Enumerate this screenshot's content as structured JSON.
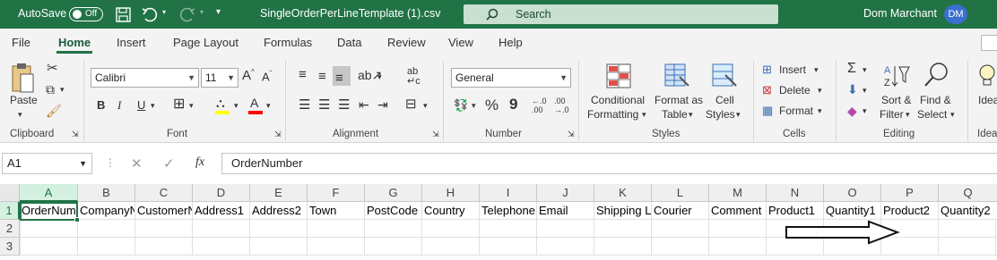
{
  "titlebar": {
    "autosave_label": "AutoSave",
    "autosave_state": "Off",
    "filename": "SingleOrderPerLineTemplate (1).csv",
    "search_placeholder": "Search",
    "user_name": "Dom Marchant",
    "user_initials": "DM",
    "icons": [
      "save-icon",
      "undo-icon",
      "redo-icon",
      "customize-icon",
      "search-icon"
    ]
  },
  "tabs": [
    "File",
    "Home",
    "Insert",
    "Page Layout",
    "Formulas",
    "Data",
    "Review",
    "View",
    "Help"
  ],
  "active_tab": "Home",
  "ribbon": {
    "clipboard": {
      "group": "Clipboard",
      "paste": "Paste"
    },
    "font": {
      "group": "Font",
      "name": "Calibri",
      "size": "11",
      "grow": "A",
      "shrink": "A",
      "bold": "B",
      "italic": "I",
      "underline": "U",
      "font_color_letter": "A",
      "fill_color": "#ffff00",
      "font_color": "#ff0000"
    },
    "alignment": {
      "group": "Alignment"
    },
    "number": {
      "group": "Number",
      "format": "General",
      "percent": "%",
      "comma": "9",
      "inc_decimal": "←.0 .00",
      "dec_decimal": ".00 →.0"
    },
    "styles": {
      "group": "Styles",
      "conditional": [
        "Conditional",
        "Formatting"
      ],
      "format_table": [
        "Format as",
        "Table"
      ],
      "cell_styles": [
        "Cell",
        "Styles"
      ]
    },
    "cells": {
      "group": "Cells",
      "insert": "Insert",
      "delete": "Delete",
      "format": "Format"
    },
    "editing": {
      "group": "Editing",
      "sort": [
        "Sort &",
        "Filter"
      ],
      "find": [
        "Find &",
        "Select"
      ]
    },
    "ideas": {
      "group": "Idea",
      "label": "Idea"
    }
  },
  "formula_bar": {
    "name_box": "A1",
    "fx": "fx",
    "value": "OrderNumber"
  },
  "grid": {
    "columns": [
      "A",
      "B",
      "C",
      "D",
      "E",
      "F",
      "G",
      "H",
      "I",
      "J",
      "K",
      "L",
      "M",
      "N",
      "O",
      "P",
      "Q"
    ],
    "rows": [
      "1",
      "2",
      "3"
    ],
    "row1": [
      "OrderNumber",
      "CompanyName",
      "CustomerName",
      "Address1",
      "Address2",
      "Town",
      "PostCode",
      "Country",
      "Telephone",
      "Email",
      "Shipping Label",
      "Courier",
      "Comment",
      "Product1",
      "Quantity1",
      "Product2",
      "Quantity2"
    ],
    "selected_cell": "A1"
  },
  "colors": {
    "brand": "#217346",
    "ribbon_bg": "#f3f3f3",
    "header_sel": "#d3f0e0"
  }
}
